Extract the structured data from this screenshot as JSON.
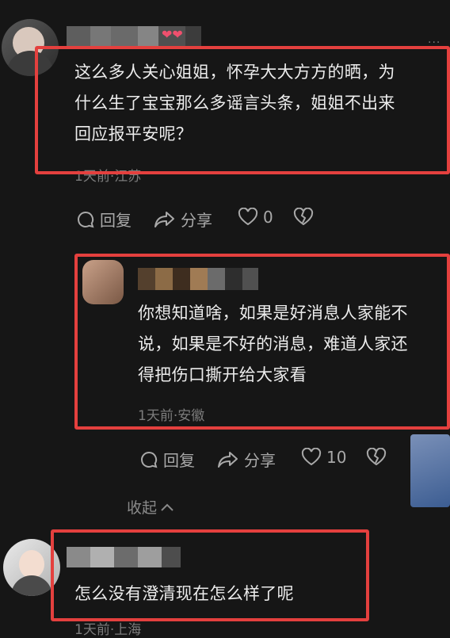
{
  "comments": [
    {
      "text": "这么多人关心姐姐，怀孕大大方方的晒，为\n什么生了宝宝那么多谣言头条，姐姐不出来\n回应报平安呢？",
      "meta": "1天前·江苏",
      "actions": {
        "reply": "回复",
        "share": "分享",
        "likes": "0"
      }
    },
    {
      "text": "你想知道啥，如果是好消息人家能不\n说，如果是不好的消息，难道人家还\n得把伤口撕开给大家看",
      "meta": "1天前·安徽",
      "actions": {
        "reply": "回复",
        "share": "分享",
        "likes": "10"
      }
    },
    {
      "text": "怎么没有澄清现在怎么样了呢",
      "meta": "1天前·上海"
    }
  ],
  "collapse_label": "收起",
  "colors": {
    "highlight": "#e4403e",
    "background": "#161616"
  }
}
